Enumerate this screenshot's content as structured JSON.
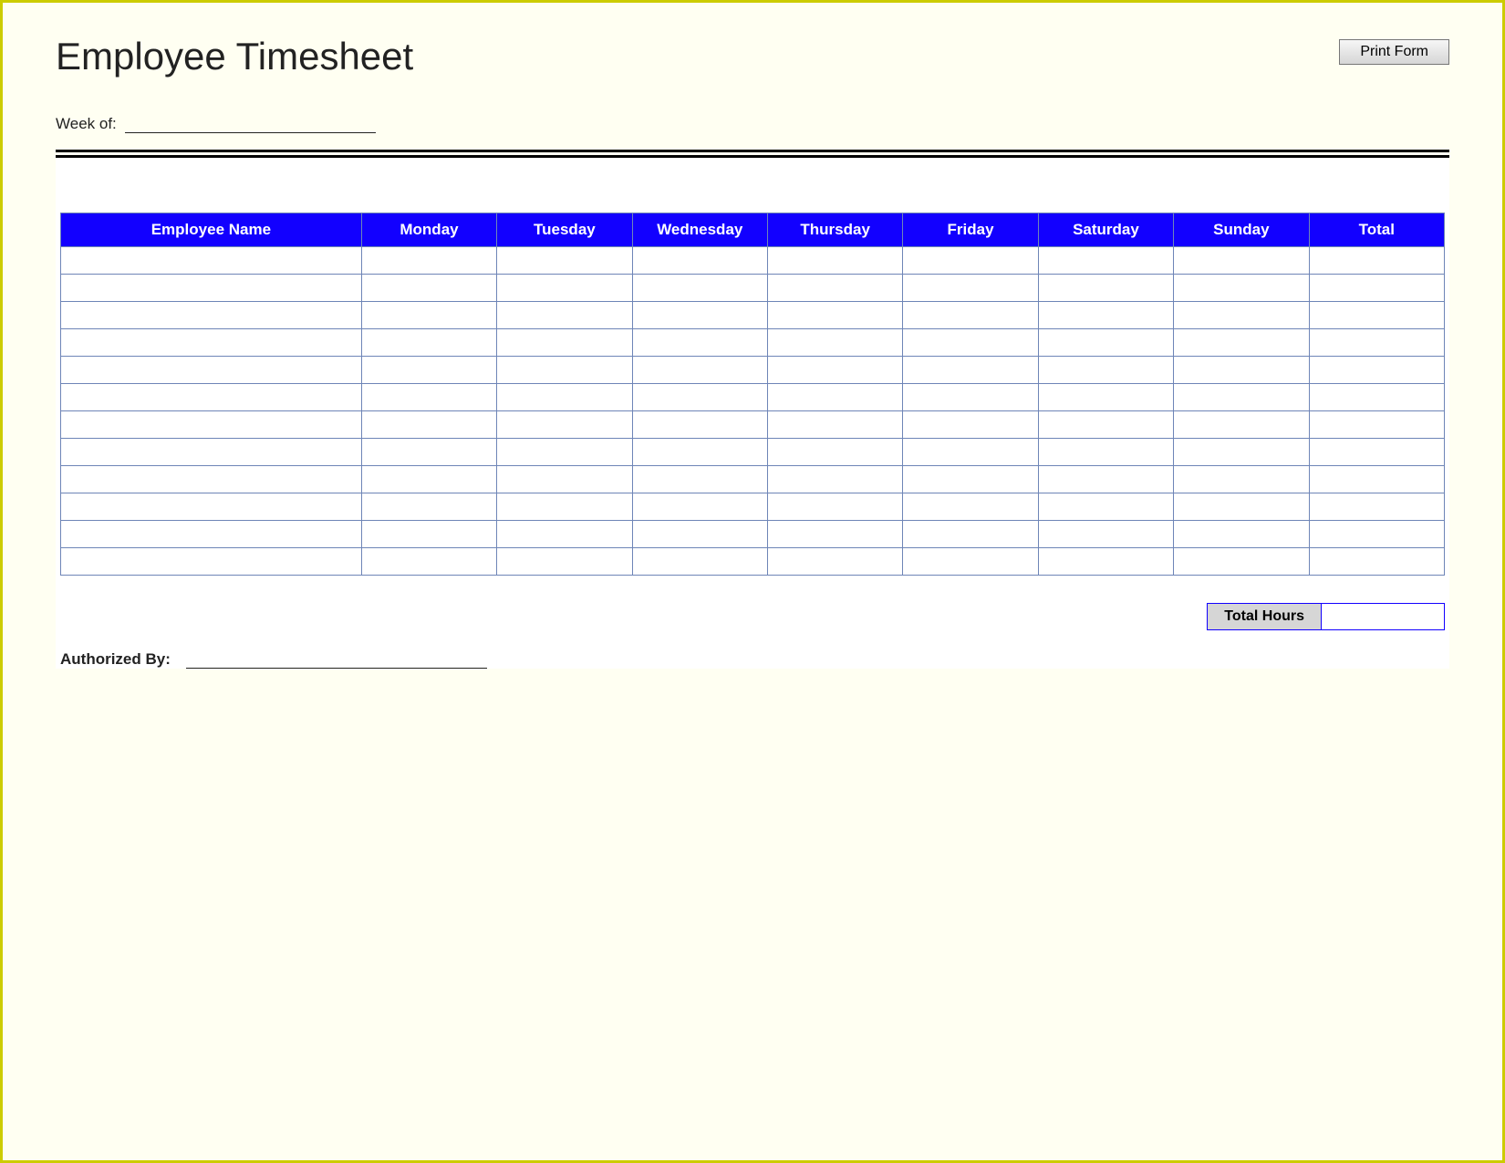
{
  "header": {
    "title": "Employee Timesheet",
    "print_button": "Print Form",
    "week_of_label": "Week of:",
    "week_of_value": ""
  },
  "table": {
    "columns": [
      "Employee Name",
      "Monday",
      "Tuesday",
      "Wednesday",
      "Thursday",
      "Friday",
      "Saturday",
      "Sunday",
      "Total"
    ],
    "rows": [
      [
        "",
        "",
        "",
        "",
        "",
        "",
        "",
        "",
        ""
      ],
      [
        "",
        "",
        "",
        "",
        "",
        "",
        "",
        "",
        ""
      ],
      [
        "",
        "",
        "",
        "",
        "",
        "",
        "",
        "",
        ""
      ],
      [
        "",
        "",
        "",
        "",
        "",
        "",
        "",
        "",
        ""
      ],
      [
        "",
        "",
        "",
        "",
        "",
        "",
        "",
        "",
        ""
      ],
      [
        "",
        "",
        "",
        "",
        "",
        "",
        "",
        "",
        ""
      ],
      [
        "",
        "",
        "",
        "",
        "",
        "",
        "",
        "",
        ""
      ],
      [
        "",
        "",
        "",
        "",
        "",
        "",
        "",
        "",
        ""
      ],
      [
        "",
        "",
        "",
        "",
        "",
        "",
        "",
        "",
        ""
      ],
      [
        "",
        "",
        "",
        "",
        "",
        "",
        "",
        "",
        ""
      ],
      [
        "",
        "",
        "",
        "",
        "",
        "",
        "",
        "",
        ""
      ],
      [
        "",
        "",
        "",
        "",
        "",
        "",
        "",
        "",
        ""
      ]
    ]
  },
  "footer": {
    "total_hours_label": "Total Hours",
    "total_hours_value": "",
    "authorized_by_label": "Authorized By:",
    "authorized_by_value": ""
  },
  "colors": {
    "header_bg": "#1200ff",
    "page_bg": "#fffff2",
    "border": "#cccc00"
  }
}
